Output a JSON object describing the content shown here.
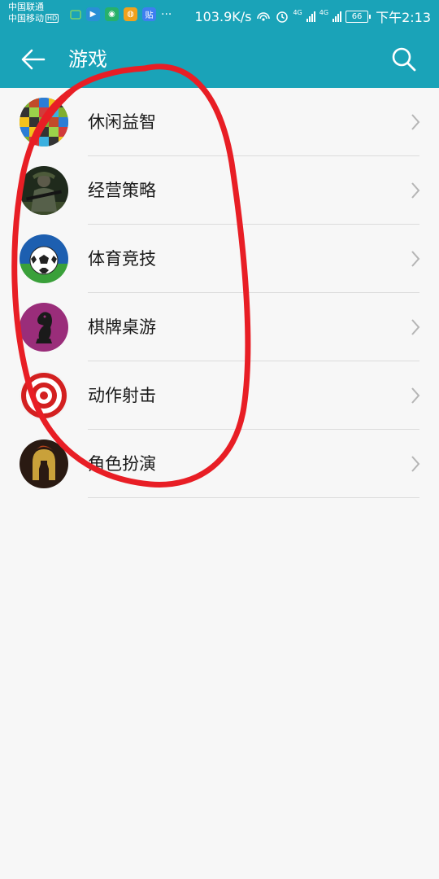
{
  "status_bar": {
    "carrier1": "中国联通",
    "carrier2": "中国移动",
    "hd": "HD",
    "notif_more": "···",
    "net_speed": "103.9K/s",
    "net_4g_1": "4G",
    "net_4g_2": "4G",
    "battery": "66",
    "time": "下午2:13",
    "notif_icons": [
      "wechat-icon",
      "video-icon",
      "camera-icon",
      "weibo-icon",
      "tieba-icon"
    ],
    "tieba_glyph": "贴"
  },
  "app_bar": {
    "title": "游戏",
    "background": "#1aa3b8"
  },
  "categories": [
    {
      "label": "休闲益智",
      "icon": "puzzle-icon"
    },
    {
      "label": "经营策略",
      "icon": "soldier-icon"
    },
    {
      "label": "体育竞技",
      "icon": "soccer-ball-icon"
    },
    {
      "label": "棋牌桌游",
      "icon": "chess-knight-icon"
    },
    {
      "label": "动作射击",
      "icon": "target-icon"
    },
    {
      "label": "角色扮演",
      "icon": "spartan-helmet-icon"
    }
  ],
  "annotation": {
    "shape": "hand-drawn ellipse",
    "color": "#e81e25"
  }
}
